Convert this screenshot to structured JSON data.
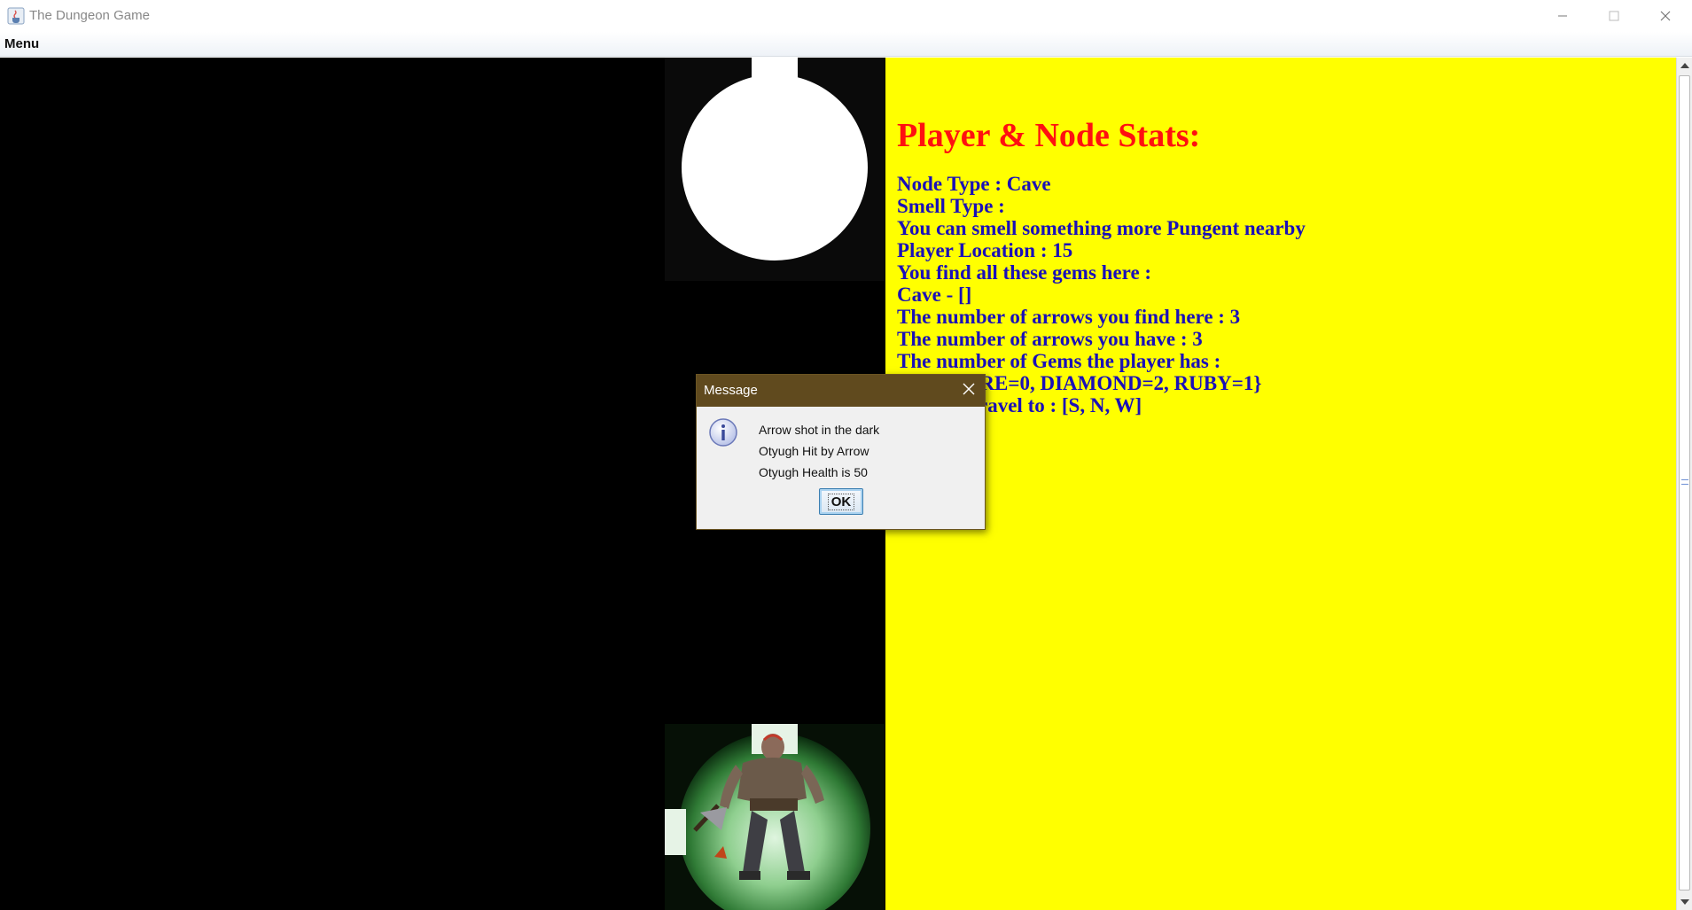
{
  "window": {
    "title": "The Dungeon Game"
  },
  "menubar": {
    "menu_label": "Menu"
  },
  "stats": {
    "heading": "Player & Node Stats:",
    "lines": [
      "Node Type : Cave",
      "Smell Type :",
      "You can smell something more Pungent nearby",
      "Player Location : 15",
      "You find all these gems here :",
      "Cave - []",
      "The number of arrows you find here : 3",
      "The number of arrows you have : 3",
      "The number of Gems the player has :",
      "{SAPPHIRE=0, DIAMOND=2, RUBY=1}",
      "You can travel to : [S, N, W]"
    ]
  },
  "dialog": {
    "title": "Message",
    "icon": "info-icon",
    "messages": [
      "Arrow shot in the dark",
      "Otyugh Hit by Arrow",
      "Otyugh Health is 50"
    ],
    "ok_label": "OK"
  },
  "colors": {
    "stats_background": "#ffff00",
    "stats_heading": "#ff1010",
    "stats_text": "#1a10b8",
    "dialog_titlebar": "#604a1e",
    "game_background": "#000000"
  },
  "map_tiles": [
    {
      "name": "explored-cave-tile",
      "icon": "cave-circle"
    },
    {
      "name": "player-tile",
      "icon": "warrior-character"
    }
  ]
}
